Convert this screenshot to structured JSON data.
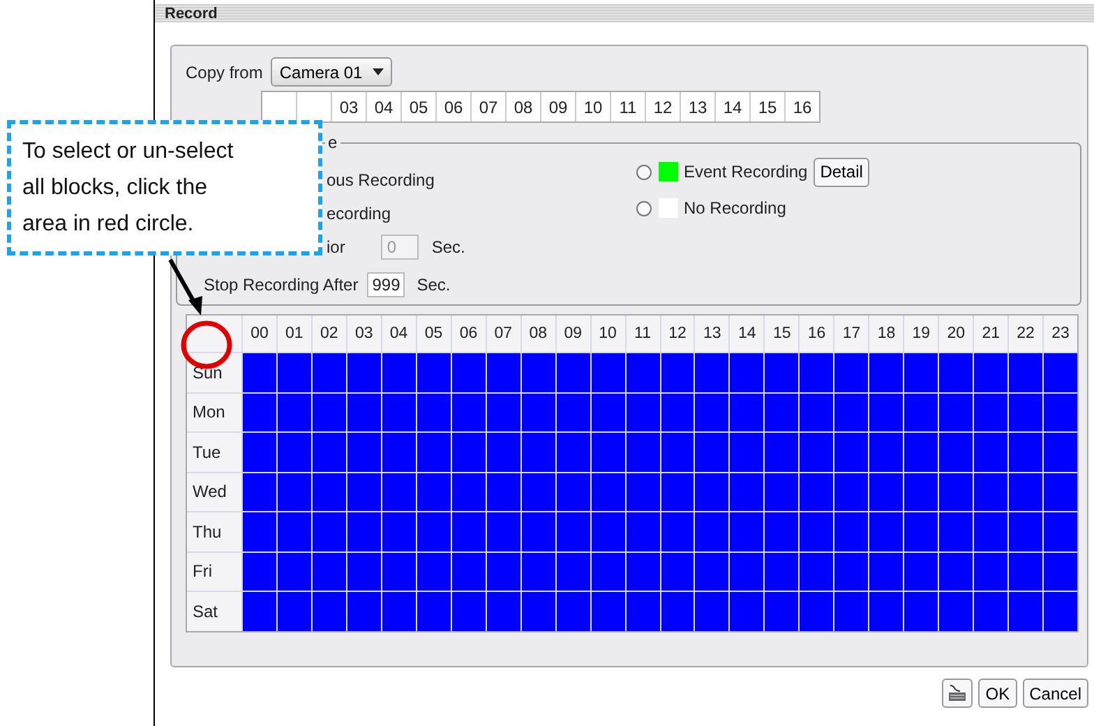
{
  "window": {
    "title": "Record"
  },
  "copy_from": {
    "label": "Copy from",
    "value": "Camera 01"
  },
  "apply_to": {
    "cameras": [
      "03",
      "04",
      "05",
      "06",
      "07",
      "08",
      "09",
      "10",
      "11",
      "12",
      "13",
      "14",
      "15",
      "16"
    ]
  },
  "mode_group": {
    "legend": "e",
    "left_items": [
      "ous Recording",
      "ecording"
    ],
    "options": [
      {
        "label": "Event Recording",
        "color": "#00ff00",
        "selected": false,
        "button": "Detail"
      },
      {
        "label": "No Recording",
        "color": "#ffffff",
        "selected": false
      }
    ],
    "prior": {
      "label": "ior",
      "value": "0",
      "disabled": true,
      "unit": "Sec."
    },
    "stop": {
      "label": "Stop Recording After",
      "value": "999",
      "disabled": false,
      "unit": "Sec."
    }
  },
  "schedule": {
    "hours": [
      "00",
      "01",
      "02",
      "03",
      "04",
      "05",
      "06",
      "07",
      "08",
      "09",
      "10",
      "11",
      "12",
      "13",
      "14",
      "15",
      "16",
      "17",
      "18",
      "19",
      "20",
      "21",
      "22",
      "23"
    ],
    "days": [
      {
        "label": "Sun",
        "slots": [
          {
            "on": true
          },
          {
            "on": true
          },
          {
            "on": true
          },
          {
            "on": true
          },
          {
            "on": true
          },
          {
            "on": true
          },
          {
            "on": true
          },
          {
            "on": true
          },
          {
            "on": true
          },
          {
            "on": true
          },
          {
            "on": true
          },
          {
            "on": true
          },
          {
            "on": true
          },
          {
            "on": true
          },
          {
            "on": true
          },
          {
            "on": true
          },
          {
            "on": true
          },
          {
            "on": true
          },
          {
            "on": true
          },
          {
            "on": true
          },
          {
            "on": true
          },
          {
            "on": true
          },
          {
            "on": true
          },
          {
            "on": true
          }
        ]
      },
      {
        "label": "Mon",
        "slots": [
          {
            "on": true
          },
          {
            "on": true
          },
          {
            "on": true
          },
          {
            "on": true
          },
          {
            "on": true
          },
          {
            "on": true
          },
          {
            "on": true
          },
          {
            "on": true
          },
          {
            "on": true
          },
          {
            "on": true
          },
          {
            "on": true
          },
          {
            "on": true
          },
          {
            "on": true
          },
          {
            "on": true
          },
          {
            "on": true
          },
          {
            "on": true
          },
          {
            "on": true
          },
          {
            "on": true
          },
          {
            "on": true
          },
          {
            "on": true
          },
          {
            "on": true
          },
          {
            "on": true
          },
          {
            "on": true
          },
          {
            "on": true
          }
        ]
      },
      {
        "label": "Tue",
        "slots": [
          {
            "on": true
          },
          {
            "on": true
          },
          {
            "on": true
          },
          {
            "on": true
          },
          {
            "on": true
          },
          {
            "on": true
          },
          {
            "on": true
          },
          {
            "on": true
          },
          {
            "on": true
          },
          {
            "on": true
          },
          {
            "on": true
          },
          {
            "on": true
          },
          {
            "on": true
          },
          {
            "on": true
          },
          {
            "on": true
          },
          {
            "on": true
          },
          {
            "on": true
          },
          {
            "on": true
          },
          {
            "on": true
          },
          {
            "on": true
          },
          {
            "on": true
          },
          {
            "on": true
          },
          {
            "on": true
          },
          {
            "on": true
          }
        ]
      },
      {
        "label": "Wed",
        "slots": [
          {
            "on": true
          },
          {
            "on": true
          },
          {
            "on": true
          },
          {
            "on": true
          },
          {
            "on": true
          },
          {
            "on": true
          },
          {
            "on": true
          },
          {
            "on": true
          },
          {
            "on": true
          },
          {
            "on": true
          },
          {
            "on": true
          },
          {
            "on": true
          },
          {
            "on": true
          },
          {
            "on": true
          },
          {
            "on": true
          },
          {
            "on": true
          },
          {
            "on": true
          },
          {
            "on": true
          },
          {
            "on": true
          },
          {
            "on": true
          },
          {
            "on": true
          },
          {
            "on": true
          },
          {
            "on": true
          },
          {
            "on": true
          }
        ]
      },
      {
        "label": "Thu",
        "slots": [
          {
            "on": true
          },
          {
            "on": true
          },
          {
            "on": true
          },
          {
            "on": true
          },
          {
            "on": true
          },
          {
            "on": true
          },
          {
            "on": true
          },
          {
            "on": true
          },
          {
            "on": true
          },
          {
            "on": true
          },
          {
            "on": true
          },
          {
            "on": true
          },
          {
            "on": true
          },
          {
            "on": true
          },
          {
            "on": true
          },
          {
            "on": true
          },
          {
            "on": true
          },
          {
            "on": true
          },
          {
            "on": true
          },
          {
            "on": true
          },
          {
            "on": true
          },
          {
            "on": true
          },
          {
            "on": true
          },
          {
            "on": true
          }
        ]
      },
      {
        "label": "Fri",
        "slots": [
          {
            "on": true
          },
          {
            "on": true
          },
          {
            "on": true
          },
          {
            "on": true
          },
          {
            "on": true
          },
          {
            "on": true
          },
          {
            "on": true
          },
          {
            "on": true
          },
          {
            "on": true
          },
          {
            "on": true
          },
          {
            "on": true
          },
          {
            "on": true
          },
          {
            "on": true
          },
          {
            "on": true
          },
          {
            "on": true
          },
          {
            "on": true
          },
          {
            "on": true
          },
          {
            "on": true
          },
          {
            "on": true
          },
          {
            "on": true
          },
          {
            "on": true
          },
          {
            "on": true
          },
          {
            "on": true
          },
          {
            "on": true
          }
        ]
      },
      {
        "label": "Sat",
        "slots": [
          {
            "on": true
          },
          {
            "on": true
          },
          {
            "on": true
          },
          {
            "on": true
          },
          {
            "on": true
          },
          {
            "on": true
          },
          {
            "on": true
          },
          {
            "on": true
          },
          {
            "on": true
          },
          {
            "on": true
          },
          {
            "on": true
          },
          {
            "on": true
          },
          {
            "on": true
          },
          {
            "on": true
          },
          {
            "on": true
          },
          {
            "on": true
          },
          {
            "on": true
          },
          {
            "on": true
          },
          {
            "on": true
          },
          {
            "on": true
          },
          {
            "on": true
          },
          {
            "on": true
          },
          {
            "on": true
          },
          {
            "on": true
          }
        ]
      }
    ]
  },
  "buttons": [
    "OK",
    "Cancel"
  ],
  "callout": {
    "lines": [
      "To select or un-select",
      "all blocks, click the",
      "area in red circle."
    ]
  }
}
